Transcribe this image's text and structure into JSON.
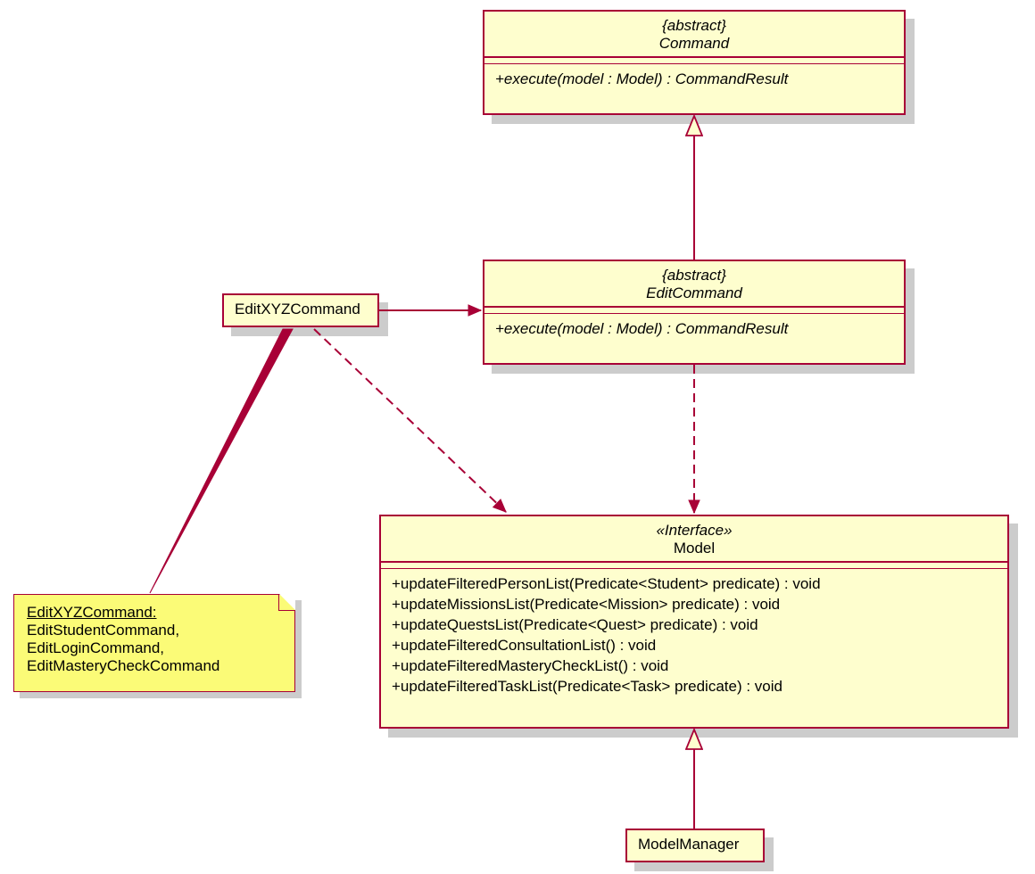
{
  "command": {
    "stereotype": "{abstract}",
    "name": "Command",
    "method": "+execute(model : Model) : CommandResult"
  },
  "editCommand": {
    "stereotype": "{abstract}",
    "name": "EditCommand",
    "method": "+execute(model : Model) : CommandResult"
  },
  "editXYZ": {
    "name": "EditXYZCommand"
  },
  "note": {
    "title": "EditXYZCommand:",
    "l1": "EditStudentCommand,",
    "l2": "EditLoginCommand,",
    "l3": "EditMasteryCheckCommand"
  },
  "model": {
    "stereotype": "«Interface»",
    "name": "Model",
    "m1": "+updateFilteredPersonList(Predicate<Student> predicate) : void",
    "m2": "+updateMissionsList(Predicate<Mission> predicate) : void",
    "m3": "+updateQuestsList(Predicate<Quest> predicate) : void",
    "m4": "+updateFilteredConsultationList() : void",
    "m5": "+updateFilteredMasteryCheckList() : void",
    "m6": "+updateFilteredTaskList(Predicate<Task> predicate) : void"
  },
  "modelManager": {
    "name": "ModelManager"
  },
  "colors": {
    "stroke": "#a80036",
    "fill": "#fefece",
    "note": "#fbfb77"
  }
}
